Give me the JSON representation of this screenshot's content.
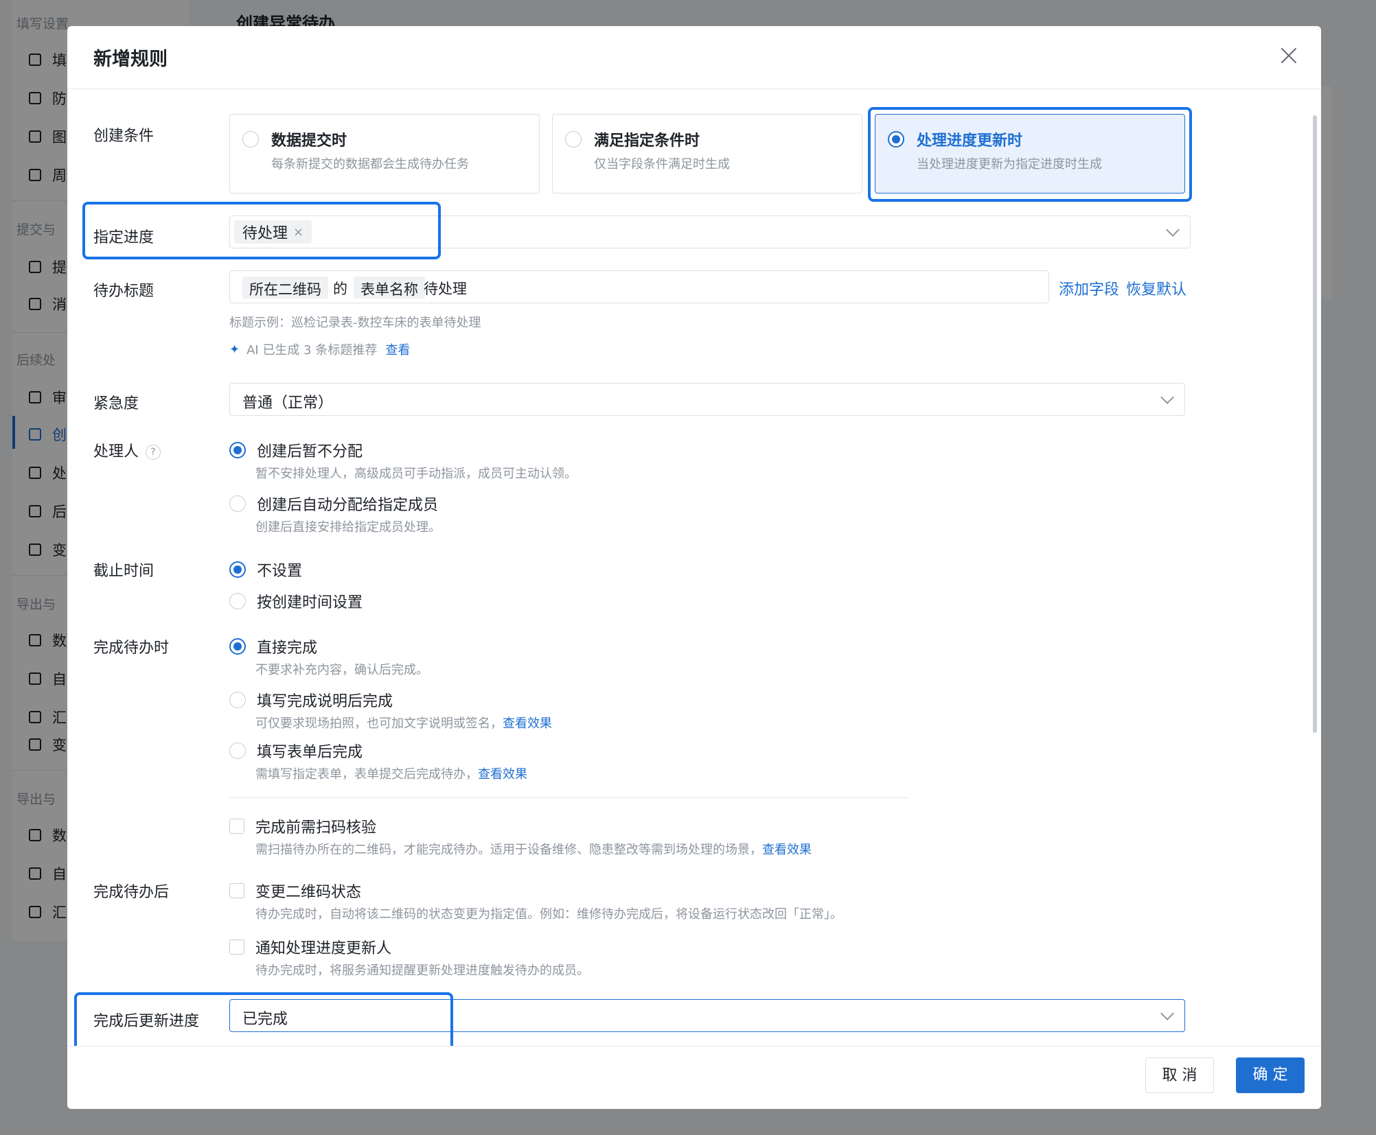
{
  "background": {
    "sidebar_groups": [
      "填写设置",
      "提交与",
      "后续处",
      "导出与",
      "导出与"
    ],
    "sidebar_items": [
      "填",
      "防",
      "图",
      "周",
      "提",
      "消",
      "审",
      "创",
      "处",
      "后",
      "变",
      "数",
      "自",
      "汇",
      "变",
      "数",
      "自",
      "汇"
    ],
    "page_title": "创建异常待办"
  },
  "modal": {
    "title": "新增规则",
    "condition_label": "创建条件",
    "conditions": [
      {
        "title": "数据提交时",
        "desc": "每条新提交的数据都会生成待办任务"
      },
      {
        "title": "满足指定条件时",
        "desc": "仅当字段条件满足时生成"
      },
      {
        "title": "处理进度更新时",
        "desc": "当处理进度更新为指定进度时生成"
      }
    ],
    "progress_label": "指定进度",
    "progress_tag": "待处理",
    "title_label": "待办标题",
    "title_tokens": [
      "所在二维码",
      "的",
      "表单名称",
      "待处理"
    ],
    "add_field": "添加字段",
    "restore_default": "恢复默认",
    "title_example": "标题示例：巡检记录表-数控车床的表单待处理",
    "ai_hint": "AI 已生成 3 条标题推荐",
    "ai_view": "查看",
    "urgency_label": "紧急度",
    "urgency_value": "普通（正常）",
    "assignee_label": "处理人",
    "help": "?",
    "assignee_options": [
      {
        "label": "创建后暂不分配",
        "desc": "暂不安排处理人，高级成员可手动指派，成员可主动认领。"
      },
      {
        "label": "创建后自动分配给指定成员",
        "desc": "创建后直接安排给指定成员处理。"
      }
    ],
    "deadline_label": "截止时间",
    "deadline_options": [
      "不设置",
      "按创建时间设置"
    ],
    "complete_label": "完成待办时",
    "complete_options": [
      {
        "label": "直接完成",
        "desc": "不要求补充内容，确认后完成。",
        "link": ""
      },
      {
        "label": "填写完成说明后完成",
        "desc": "可仅要求现场拍照，也可加文字说明或签名，",
        "link": "查看效果"
      },
      {
        "label": "填写表单后完成",
        "desc": "需填写指定表单，表单提交后完成待办，",
        "link": "查看效果"
      }
    ],
    "scan_check": {
      "label": "完成前需扫码核验",
      "desc": "需扫描待办所在的二维码，才能完成待办。适用于设备维修、隐患整改等需到场处理的场景，",
      "link": "查看效果"
    },
    "after_label": "完成待办后",
    "after_options": [
      {
        "label": "变更二维码状态",
        "desc": "待办完成时，自动将该二维码的状态变更为指定值。例如：维修待办完成后，将设备运行状态改回「正常」。"
      },
      {
        "label": "通知处理进度更新人",
        "desc": "待办完成时，将服务通知提醒更新处理进度触发待办的成员。"
      }
    ],
    "update_progress_label": "完成后更新进度",
    "update_progress_value": "已完成",
    "cancel": "取 消",
    "ok": "确 定"
  },
  "colors": {
    "accent": "#1f6fd1",
    "highlight": "#1a73e8"
  }
}
